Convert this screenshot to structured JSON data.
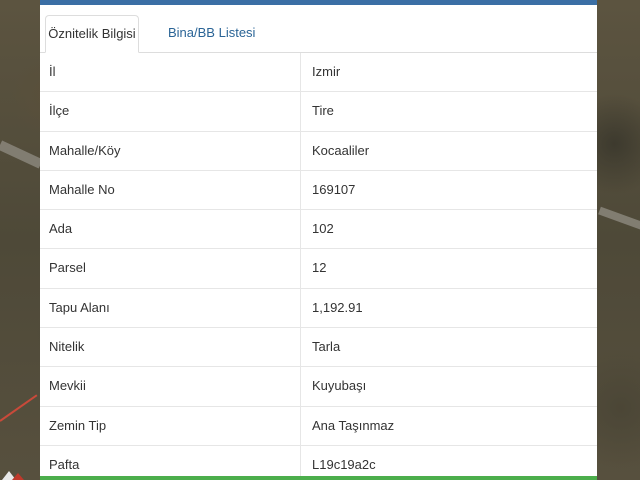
{
  "tabs": [
    {
      "label": "Öznitelik Bilgisi",
      "active": true
    },
    {
      "label": "Bina/BB Listesi",
      "active": false
    }
  ],
  "rows": [
    {
      "label": "İl",
      "value": "Izmir"
    },
    {
      "label": "İlçe",
      "value": "Tire"
    },
    {
      "label": "Mahalle/Köy",
      "value": "Kocaaliler"
    },
    {
      "label": "Mahalle No",
      "value": "169107"
    },
    {
      "label": "Ada",
      "value": "102"
    },
    {
      "label": "Parsel",
      "value": "12"
    },
    {
      "label": "Tapu Alanı",
      "value": "1,192.91"
    },
    {
      "label": "Nitelik",
      "value": "Tarla"
    },
    {
      "label": "Mevkii",
      "value": "Kuyubaşı"
    },
    {
      "label": "Zemin Tip",
      "value": "Ana Taşınmaz"
    },
    {
      "label": "Pafta",
      "value": "L19c19a2c"
    }
  ],
  "colors": {
    "header_bar": "#3b6fa5",
    "tab_link": "#2a6496",
    "footer_strip": "#4cae4c"
  }
}
